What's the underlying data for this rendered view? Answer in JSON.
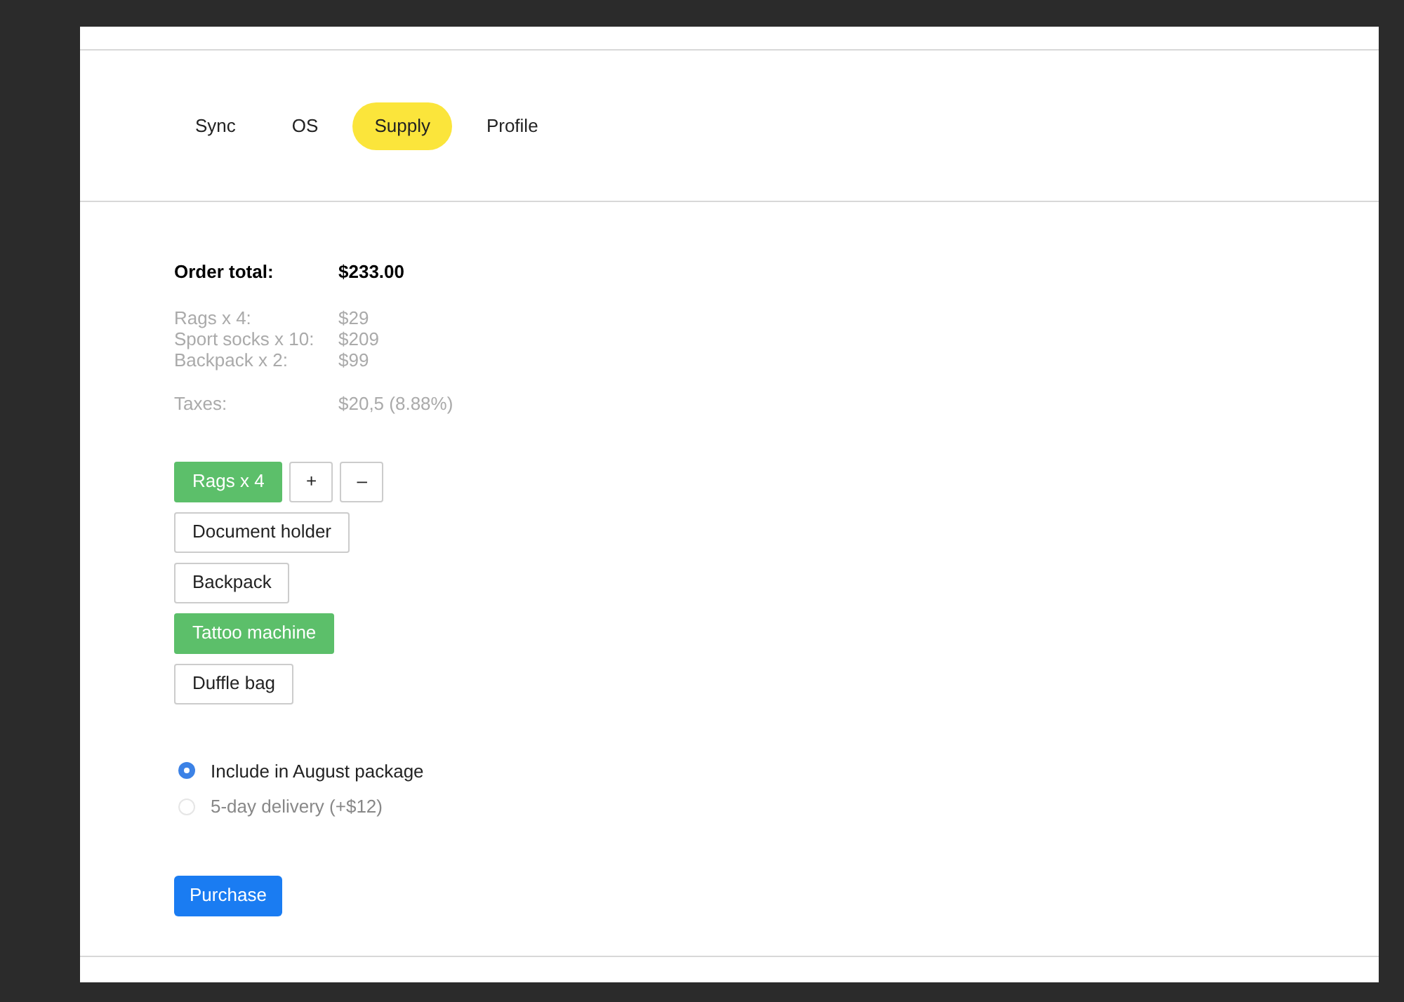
{
  "tabs": [
    {
      "label": "Sync",
      "selected": false
    },
    {
      "label": "OS",
      "selected": false
    },
    {
      "label": "Supply",
      "selected": true
    },
    {
      "label": "Profile",
      "selected": false
    }
  ],
  "order": {
    "total_label": "Order total:",
    "total_value": "$233.00",
    "lines": [
      {
        "label": "Rags x 4:",
        "value": "$29"
      },
      {
        "label": "Sport socks x 10:",
        "value": "$209"
      },
      {
        "label": "Backpack x 2:",
        "value": "$99"
      }
    ],
    "taxes": {
      "label": "Taxes:",
      "value": "$20,5 (8.88%)"
    }
  },
  "products": [
    {
      "label": "Rags x 4",
      "selected": true,
      "controls": [
        "+",
        "–"
      ]
    },
    {
      "label": "Document holder",
      "selected": false
    },
    {
      "label": "Backpack",
      "selected": false
    },
    {
      "label": "Tattoo machine",
      "selected": true
    },
    {
      "label": "Duffle bag",
      "selected": false
    }
  ],
  "options": [
    {
      "label": "Include in August package",
      "selected": true
    },
    {
      "label": "5-day delivery (+$12)",
      "selected": false
    }
  ],
  "purchase_button": "Purchase"
}
